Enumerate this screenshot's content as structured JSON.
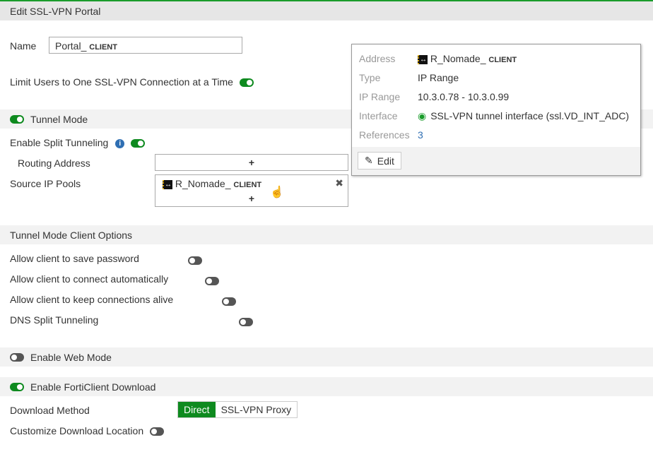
{
  "header": {
    "title": "Edit SSL-VPN Portal"
  },
  "name": {
    "label": "Name",
    "value_main": "Portal_ ",
    "value_suffix": "CLIENT"
  },
  "limit_users": {
    "label": "Limit Users to One SSL-VPN Connection at a Time",
    "enabled": true
  },
  "tunnel_mode": {
    "label": "Tunnel Mode",
    "enabled": true,
    "split_tunneling": {
      "label": "Enable Split Tunneling",
      "enabled": true
    },
    "routing_address": {
      "label": "Routing Address",
      "add": "+"
    },
    "source_ip_pools": {
      "label": "Source IP Pools",
      "item_main": "R_Nomade_ ",
      "item_suffix": "CLIENT",
      "remove": "✖",
      "add": "+"
    }
  },
  "client_options": {
    "title": "Tunnel Mode Client Options",
    "items": [
      {
        "label": "Allow client to save password",
        "enabled": false
      },
      {
        "label": "Allow client to connect automatically",
        "enabled": false
      },
      {
        "label": "Allow client to keep connections alive",
        "enabled": false
      },
      {
        "label": "DNS Split Tunneling",
        "enabled": false
      }
    ]
  },
  "web_mode": {
    "label": "Enable Web Mode",
    "enabled": false
  },
  "forticlient": {
    "label": "Enable FortiClient Download",
    "enabled": true,
    "method_label": "Download Method",
    "methods": [
      "Direct",
      "SSL-VPN Proxy"
    ],
    "selected": "Direct",
    "custom_location_label": "Customize Download Location",
    "custom_location_enabled": false
  },
  "popup": {
    "address_label": "Address",
    "address_main": "R_Nomade_ ",
    "address_suffix": "CLIENT",
    "type_label": "Type",
    "type": "IP Range",
    "range_label": "IP Range",
    "range": "10.3.0.78 - 10.3.0.99",
    "interface_label": "Interface",
    "interface": "SSL-VPN tunnel interface (ssl.VD_INT_ADC)",
    "references_label": "References",
    "references": "3",
    "edit": "Edit"
  },
  "colors": {
    "accent": "#0e8a1f"
  }
}
